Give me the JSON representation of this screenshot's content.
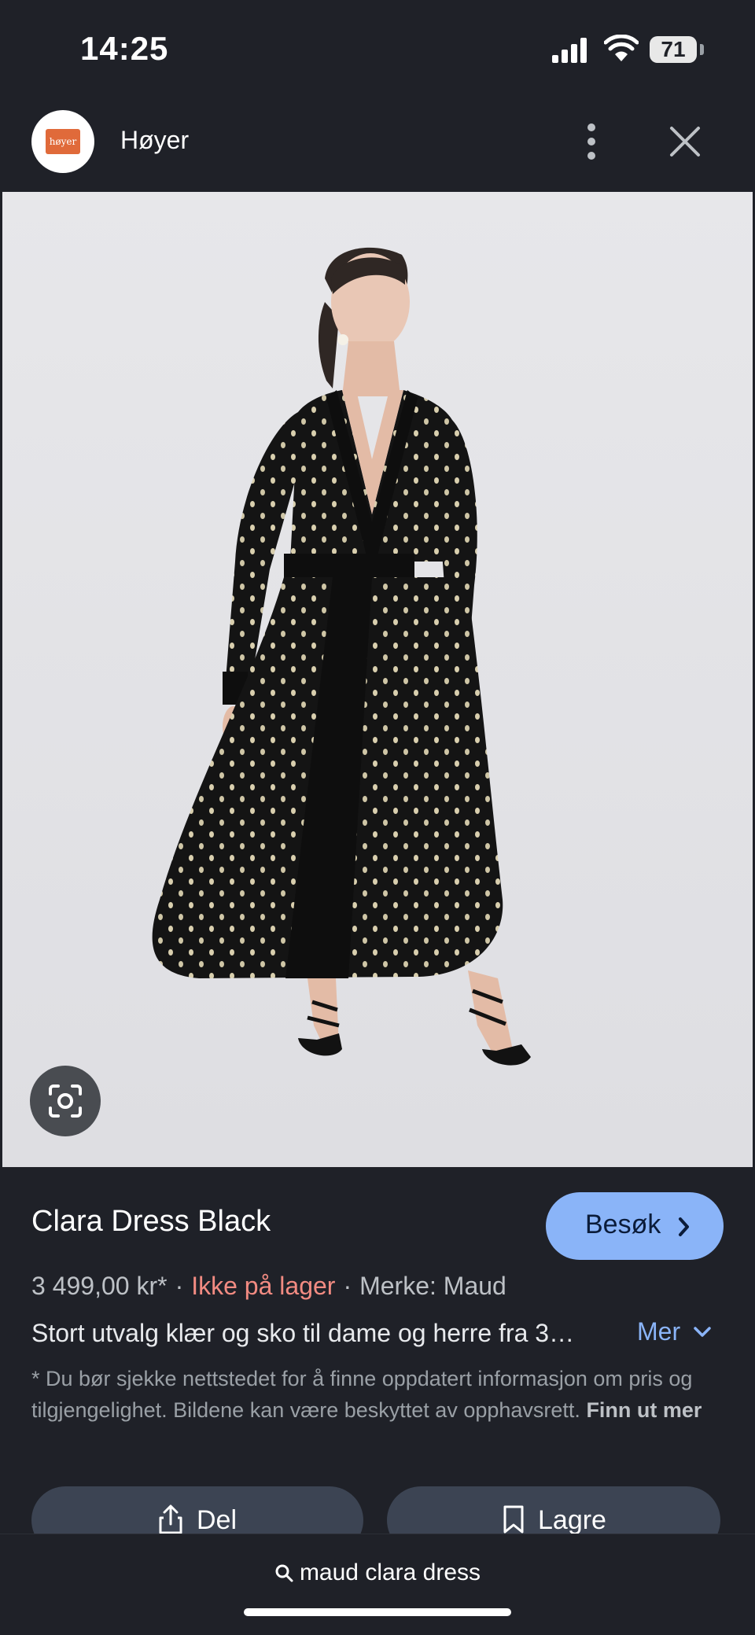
{
  "status_bar": {
    "time": "14:25",
    "battery": "71"
  },
  "header": {
    "site_name": "Høyer",
    "logo_text": "høyer"
  },
  "product": {
    "title": "Clara Dress Black",
    "visit_label": "Besøk",
    "price": "3 499,00 kr*",
    "stock": "Ikke på lager",
    "brand": "Merke: Maud",
    "description": "Stort utvalg klær og sko til dame og herre fra 3…",
    "more_label": "Mer",
    "disclaimer": "* Du bør sjekke nettstedet for å finne oppdatert informasjon om pris og tilgjengelighet. Bildene kan være beskyttet av opphavsrett.",
    "learn_more": "Finn ut mer"
  },
  "actions": {
    "share_label": "Del",
    "save_label": "Lagre"
  },
  "search": {
    "query": "maud clara dress"
  },
  "colors": {
    "accent": "#8ab4f8",
    "stock_red": "#f28b82",
    "background": "#1f2128"
  }
}
